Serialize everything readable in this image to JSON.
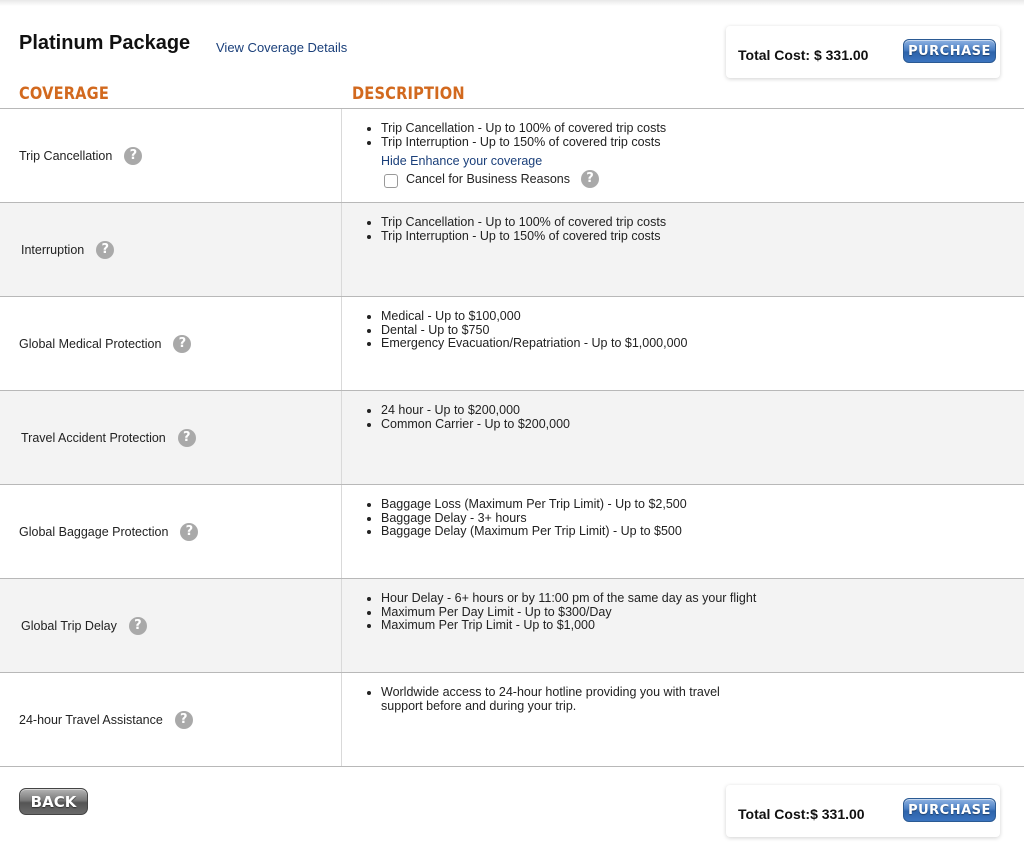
{
  "header": {
    "title": "Platinum Package",
    "details_link": "View Coverage Details",
    "total_label_top": "Total Cost: $",
    "total_amount": "331.00",
    "total_label_bottom": "Total Cost:$",
    "purchase_label": "PURCHASE"
  },
  "columns": {
    "coverage": "COVERAGE",
    "description": "DESCRIPTION"
  },
  "rows": [
    {
      "name": "Trip Cancellation",
      "items": [
        "Trip Cancellation - Up to 100% of covered trip costs",
        "Trip Interruption - Up to 150% of covered trip costs"
      ],
      "enhance_link": "Hide Enhance your coverage",
      "option_label": "Cancel for Business Reasons"
    },
    {
      "name": "Interruption",
      "items": [
        "Trip Cancellation - Up to 100% of covered trip costs",
        "Trip Interruption - Up to 150% of covered trip costs"
      ]
    },
    {
      "name": "Global Medical Protection",
      "items": [
        "Medical - Up to $100,000",
        "Dental - Up to $750",
        "Emergency Evacuation/Repatriation - Up to $1,000,000"
      ]
    },
    {
      "name": "Travel Accident Protection",
      "items": [
        "24 hour - Up to $200,000",
        "Common Carrier - Up to $200,000"
      ]
    },
    {
      "name": "Global Baggage Protection",
      "items": [
        "Baggage Loss (Maximum Per Trip Limit) - Up to $2,500",
        "Baggage Delay - 3+ hours",
        "Baggage Delay (Maximum Per Trip Limit) - Up to $500"
      ]
    },
    {
      "name": "Global Trip Delay",
      "items": [
        "Hour Delay - 6+ hours or by 11:00 pm of the same day as your flight",
        "Maximum Per Day Limit - Up to $300/Day",
        "Maximum Per Trip Limit - Up to $1,000"
      ]
    },
    {
      "name": "24-hour Travel Assistance",
      "items": [
        "Worldwide access to 24-hour hotline providing you with travel support before and during your trip."
      ]
    }
  ],
  "footer": {
    "back_label": "BACK"
  },
  "icons": {
    "help": "question-mark-icon",
    "help_glyph": "?"
  },
  "colors": {
    "accent": "#d2691e",
    "link": "#1a3f7a",
    "button_blue": "#3b74bf"
  }
}
